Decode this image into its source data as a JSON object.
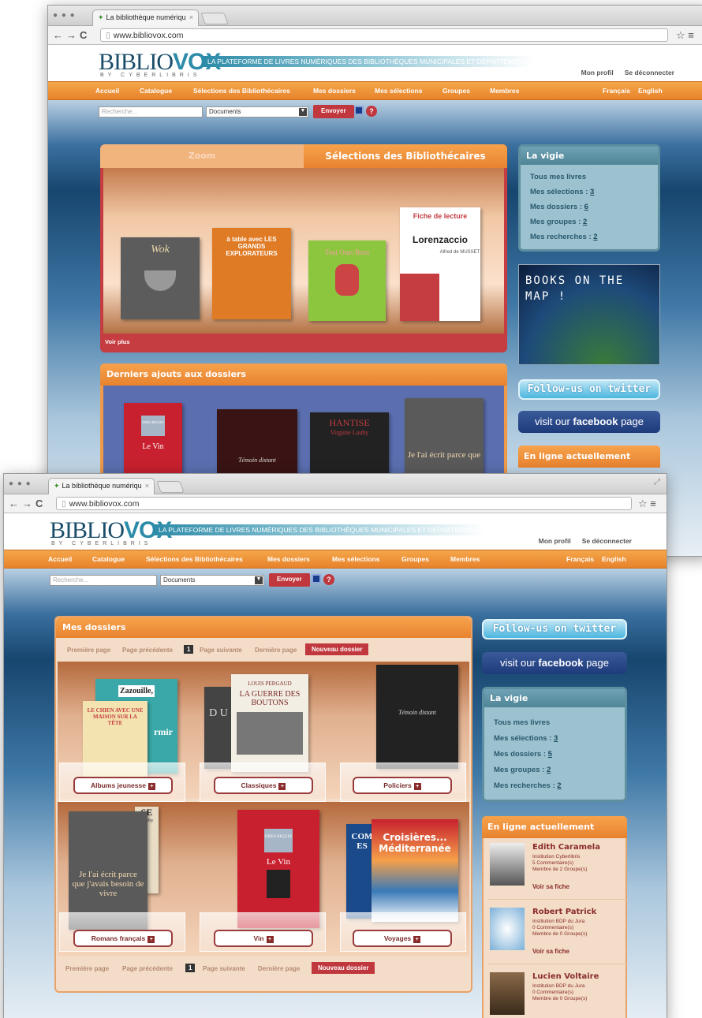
{
  "back": {
    "tab_title": "La bibliothèque numériqu",
    "url": "www.bibliovox.com",
    "logo_main": "BIBLIO",
    "logo_vox": "VOX",
    "logo_by": "BY CYBERLIBRIS",
    "slogan": "LA PLATEFORME DE LIVRES NUMÉRIQUES DES BIBLIOTHÈQUES MUNICIPALES ET DÉPARTEMENTALES",
    "profile": "Mon profil",
    "logout": "Se déconnecter",
    "menu": [
      "Accueil",
      "Catalogue",
      "Sélections des Bibliothécaires",
      "Mes dossiers",
      "Mes sélections",
      "Groupes",
      "Membres"
    ],
    "lang_fr": "Français",
    "lang_en": "English",
    "search_placeholder": "Recherche...",
    "search_select": "Documents",
    "search_button": "Envoyer",
    "tab_zoom": "Zoom",
    "tab_selections": "Sélections des Bibliothécaires",
    "voir_plus": "Voir plus",
    "books": [
      {
        "title": "Wok",
        "color": "#6b6b6b"
      },
      {
        "title": "à table avec LES GRANDS EXPLORATEURS",
        "color": "#e07b25"
      },
      {
        "title": "Tout Ours Brun",
        "color": "#8cc63f"
      },
      {
        "title": "Fiche de lecture",
        "subtitle": "Lorenzaccio",
        "author": "Alfred de MUSSET",
        "color": "#ffffff"
      }
    ],
    "derniers_title": "Derniers ajouts aux dossiers",
    "derniers_books": [
      {
        "title": "Le Vin",
        "top": "IDÉES REÇUES",
        "color": "#c8202e"
      },
      {
        "title": "Témoin distant",
        "color": "#4a1a1a"
      },
      {
        "title": "HANTISE",
        "subtitle": "Virginie Lauby",
        "color": "#2a2a2a"
      },
      {
        "title": "Je l'ai écrit parce que",
        "color": "#6a6a6a"
      }
    ],
    "vigie_title": "La vigie",
    "vigie": {
      "all": "Tous mes livres",
      "sel_label": "Mes sélections : ",
      "sel_count": "3",
      "dos_label": "Mes dossiers : ",
      "dos_count": "6",
      "grp_label": "Mes groupes : ",
      "grp_count": "2",
      "rec_label": "Mes recherches : ",
      "rec_count": "2"
    },
    "books_on_map": "BOOKS ON THE MAP !",
    "twitter": "Follow-us on twitter",
    "facebook_pre": "visit our ",
    "facebook_bold": "facebook",
    "facebook_post": " page",
    "en_ligne": "En ligne actuellement"
  },
  "front": {
    "tab_title": "La bibliothèque numériqu",
    "url": "www.bibliovox.com",
    "profile": "Mon profil",
    "logout": "Se déconnecter",
    "menu": [
      "Accueil",
      "Catalogue",
      "Sélections des Bibliothécaires",
      "Mes dossiers",
      "Mes sélections",
      "Groupes",
      "Membres"
    ],
    "lang_fr": "Français",
    "lang_en": "English",
    "search_placeholder": "Recherche...",
    "search_select": "Documents",
    "search_button": "Envoyer",
    "mes_dossiers": "Mes dossiers",
    "pager": {
      "first": "Première page",
      "prev": "Page précédente",
      "num": "1",
      "next": "Page suivante",
      "last": "Dernière page",
      "new": "Nouveau dossier"
    },
    "folders": [
      {
        "label": "Albums jeunesse"
      },
      {
        "label": "Classiques"
      },
      {
        "label": "Policiers"
      },
      {
        "label": "Romans français"
      },
      {
        "label": "Vin"
      },
      {
        "label": "Voyages"
      }
    ],
    "covers": {
      "zazouille": "Zazouille,",
      "chien": "LE CHIEN AVEC UNE MAISON SUR LA TÊTE",
      "dormir": "rmir",
      "pergaud_author": "LOUIS PERGAUD",
      "pergaud_title": "LA GUERRE DES BOUTONS",
      "du": "D U",
      "temoin": "Témoin distant",
      "je_lai": "Je l'ai écrit parce que j'avais besoin de vivre",
      "se": "SE",
      "lauby": "Lauby",
      "vin_top": "IDÉES REÇUES",
      "vin": "Le Vin",
      "croisieres": "Croisières... Méditerranée",
      "es": "COM ES"
    },
    "vigie_title": "La vigie",
    "vigie": {
      "all": "Tous mes livres",
      "sel_label": "Mes sélections : ",
      "sel_count": "3",
      "dos_label": "Mes dossiers : ",
      "dos_count": "5",
      "grp_label": "Mes groupes : ",
      "grp_count": "2",
      "rec_label": "Mes recherches : ",
      "rec_count": "2"
    },
    "twitter": "Follow-us on twitter",
    "facebook_pre": "visit our ",
    "facebook_bold": "facebook",
    "facebook_post": " page",
    "en_ligne": "En ligne actuellement",
    "members": [
      {
        "name": "Edith Caramela",
        "inst": "Institution Cyberlibris",
        "comments": "5 Commentaire(s)",
        "groups": "Membre de 2 Groupe(s)",
        "link": "Voir sa fiche"
      },
      {
        "name": "Robert Patrick",
        "inst": "Institution BDP du Jura",
        "comments": "0 Commentaire(s)",
        "groups": "Membre de 0 Groupe(s)",
        "link": "Voir sa fiche"
      },
      {
        "name": "Lucien Voltaire",
        "inst": "Institution BDP du Jura",
        "comments": "0 Commentaire(s)",
        "groups": "Membre de 0 Groupe(s)"
      }
    ]
  }
}
